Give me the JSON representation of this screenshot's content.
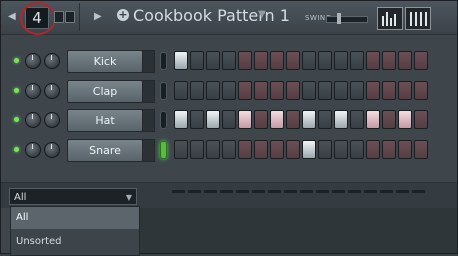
{
  "toolbar": {
    "pattern_number": "4",
    "pattern_name": "Cookbook Pattern 1",
    "swing_label": "SWING"
  },
  "channels": [
    {
      "name": "Kick",
      "selected": false,
      "steps": [
        1,
        0,
        0,
        0,
        0,
        0,
        0,
        0,
        0,
        0,
        0,
        0,
        0,
        0,
        0,
        0
      ]
    },
    {
      "name": "Clap",
      "selected": false,
      "steps": [
        0,
        0,
        0,
        0,
        0,
        0,
        0,
        0,
        0,
        0,
        0,
        0,
        0,
        0,
        0,
        0
      ]
    },
    {
      "name": "Hat",
      "selected": false,
      "steps": [
        1,
        0,
        1,
        0,
        1,
        0,
        1,
        0,
        1,
        0,
        1,
        0,
        1,
        0,
        1,
        0
      ]
    },
    {
      "name": "Snare",
      "selected": true,
      "steps": [
        0,
        0,
        0,
        0,
        0,
        0,
        0,
        0,
        1,
        0,
        0,
        0,
        0,
        0,
        0,
        0
      ]
    }
  ],
  "filter": {
    "selected": "All",
    "options": [
      "All",
      "Unsorted"
    ]
  },
  "colors": {
    "step_group_gray": "#42494e",
    "step_group_red": "#5e464c",
    "active_led": "#6fe05c",
    "highlight_circle": "#b0262b"
  }
}
